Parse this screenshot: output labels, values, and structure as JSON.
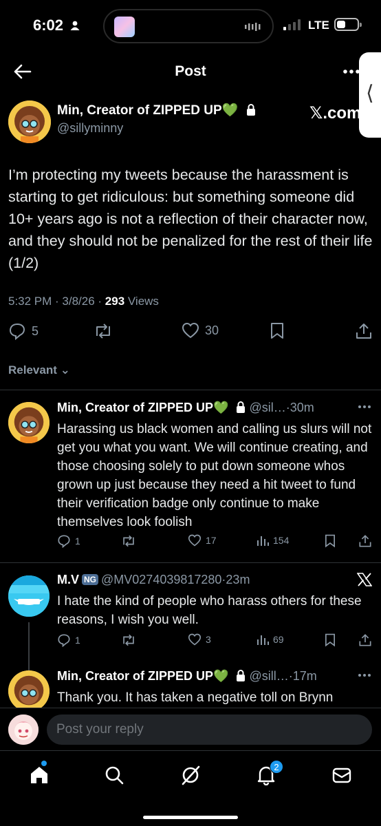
{
  "status_bar": {
    "time": "6:02",
    "network": "LTE"
  },
  "header": {
    "title": "Post"
  },
  "side_tab": {
    "glyph": "⟨"
  },
  "main_post": {
    "author_name": "Min, Creator of ZIPPED UP",
    "author_emoji": "💚",
    "handle": "@sillyminny",
    "site_label": "𝕏.com",
    "text": "I’m protecting my tweets because the harassment is starting to get ridiculous: but something someone did 10+ years ago is not a reflection of their character now, and they should not be penalized for the rest of their life (1/2)",
    "timestamp": "5:32 PM · 3/8/26 · ",
    "views_count": "293",
    "views_label": " Views",
    "replies": "5",
    "likes": "30"
  },
  "sort": {
    "label": "Relevant",
    "chevron": "⌄"
  },
  "replies": [
    {
      "name": "Min, Creator of ZIPPED UP",
      "emoji": "💚",
      "handle_time": " @sil…·30m",
      "text": "Harassing us black women and calling us slurs will not get you what you want. We will continue creating, and those choosing solely to put down someone whos grown up just because they need a hit tweet to fund their verification badge only continue to make themselves look foolish",
      "replies": "1",
      "likes": "17",
      "views": "154"
    },
    {
      "name": "M.V",
      "badge": "NG",
      "handle_time": "@MV0274039817280·23m",
      "text": "I hate the kind of people who harass others for these reasons, I wish you well.",
      "replies": "1",
      "likes": "3",
      "views": "69"
    },
    {
      "name": "Min, Creator of ZIPPED UP",
      "emoji": "💚",
      "handle_time": " @sill…·17m",
      "text": "Thank you. It has taken a negative toll on Brynn"
    }
  ],
  "composer": {
    "placeholder": "Post your reply"
  },
  "nav": {
    "notifications_count": "2"
  },
  "colors": {
    "accent": "#1d9bf0",
    "muted": "#8b98a5",
    "background": "#000000"
  },
  "icons": [
    "person-icon",
    "back-arrow-icon",
    "more-icon",
    "lock-icon",
    "reply-icon",
    "repost-icon",
    "like-icon",
    "bookmark-icon",
    "share-icon",
    "views-icon",
    "x-logo-icon",
    "home-icon",
    "search-icon",
    "grok-icon",
    "bell-icon",
    "mail-icon"
  ]
}
